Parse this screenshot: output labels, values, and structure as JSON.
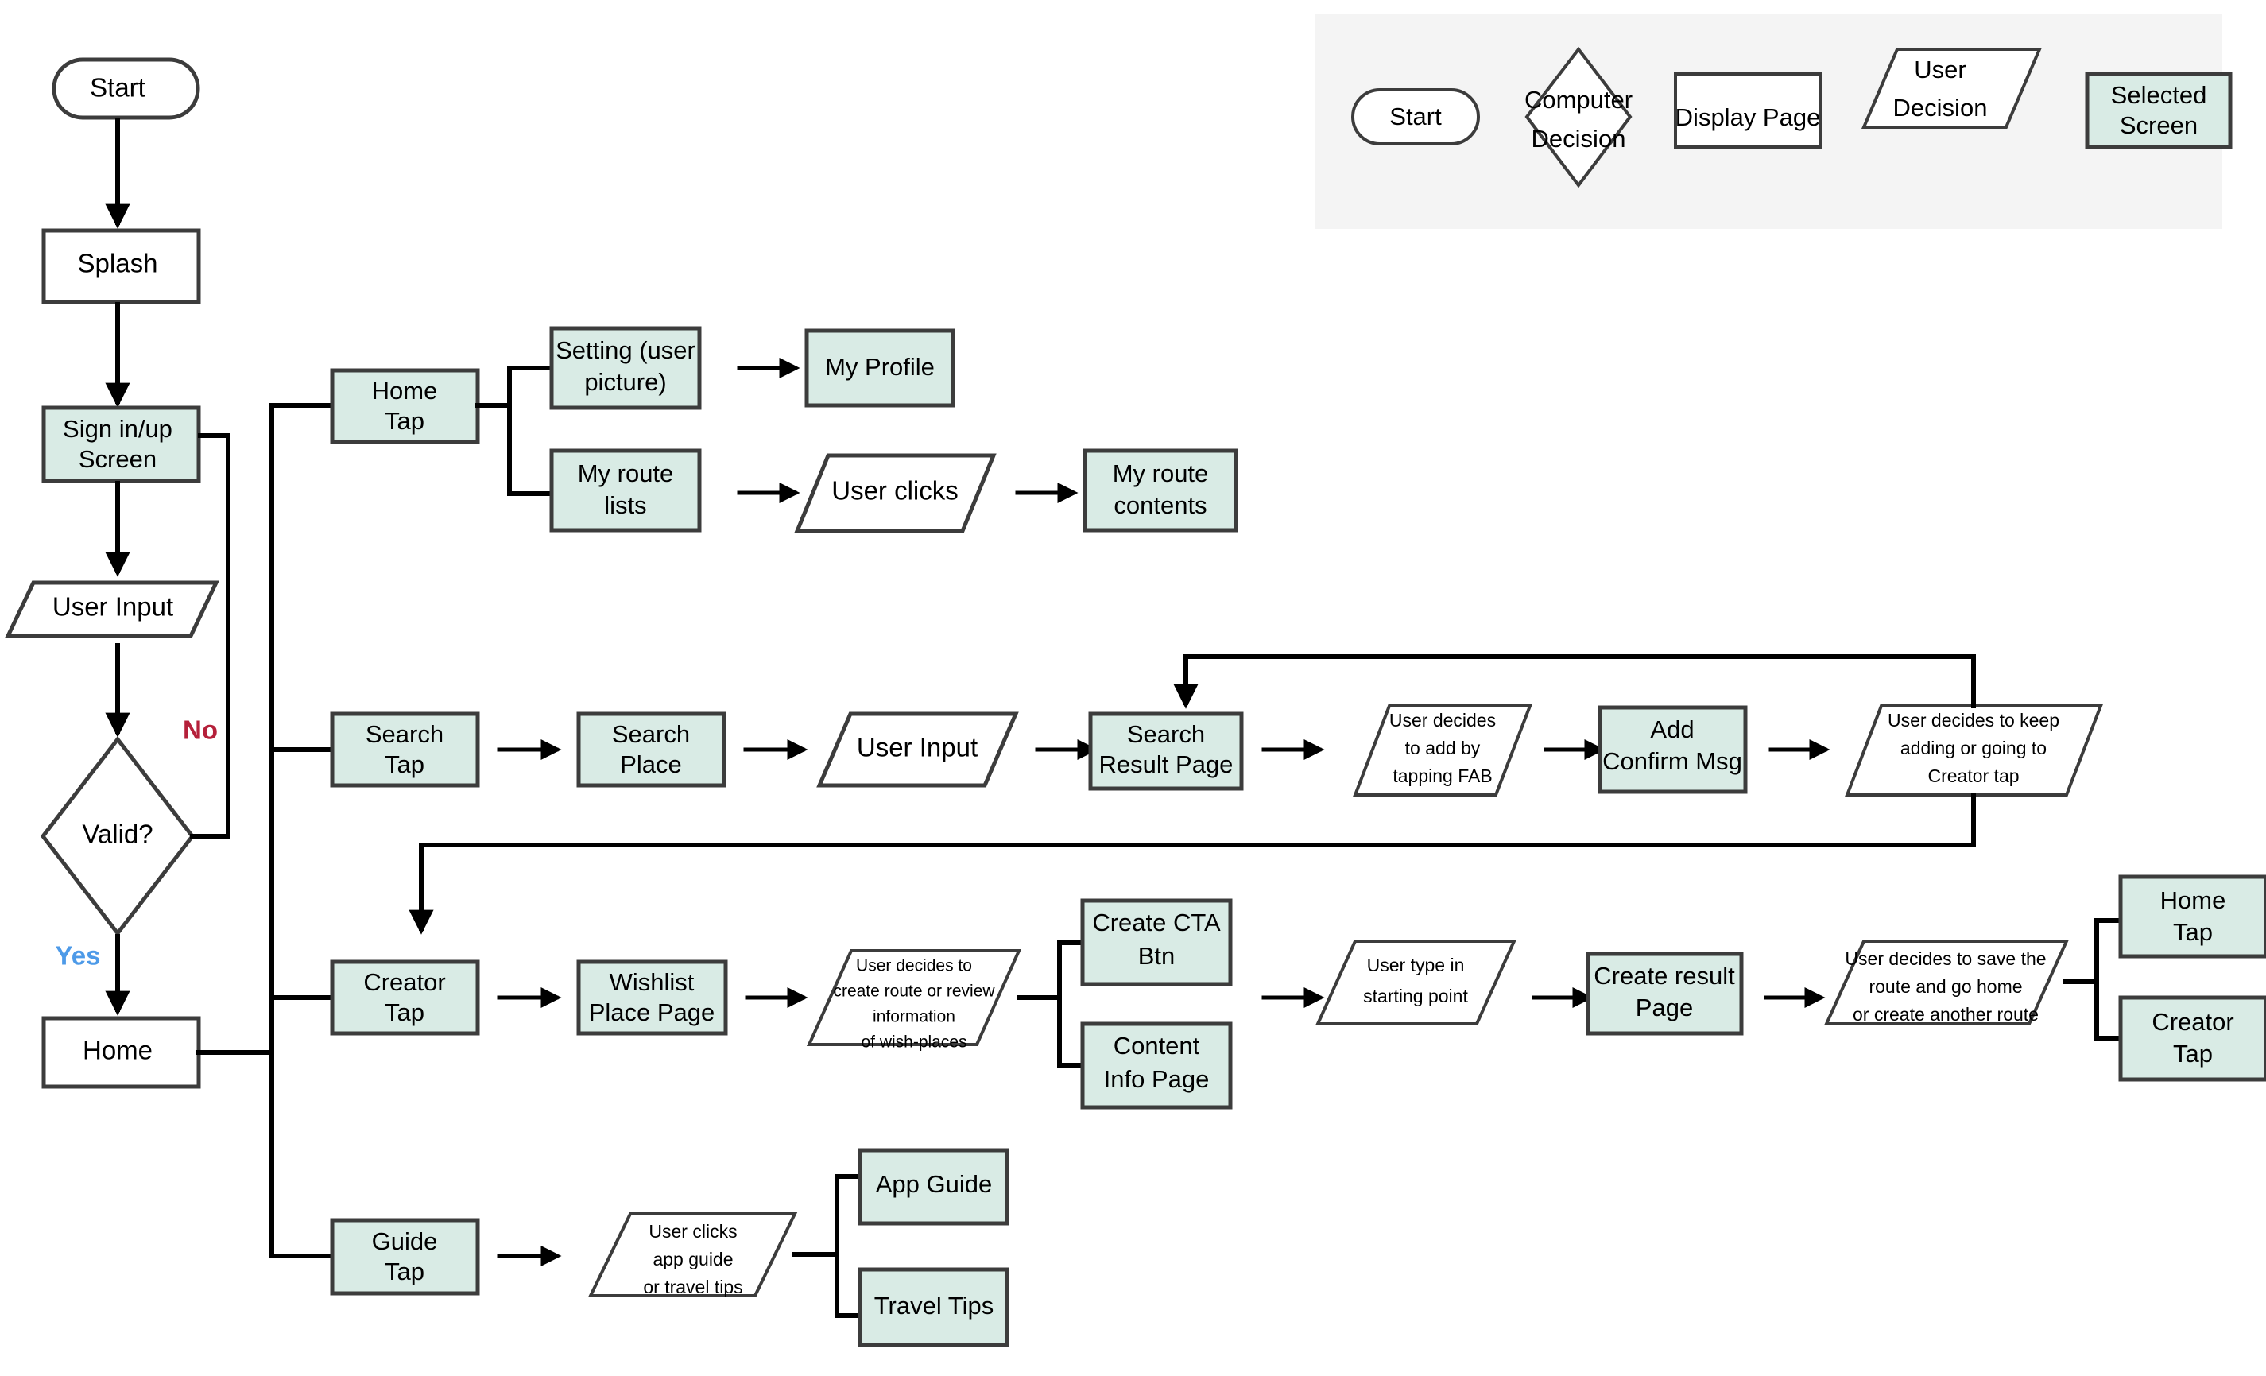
{
  "legend": {
    "title": "",
    "items": [
      {
        "id": "start",
        "label": "Start",
        "shape": "terminator"
      },
      {
        "id": "computer",
        "label": "Computer\nDecision",
        "shape": "diamond"
      },
      {
        "id": "display",
        "label": "Display Page",
        "shape": "rect"
      },
      {
        "id": "userdec",
        "label": "User\nDecision",
        "shape": "parallelogram"
      },
      {
        "id": "selected",
        "label": "Selected\nScreen",
        "shape": "rect-filled"
      }
    ],
    "background_color": "#f4f4f4"
  },
  "colors": {
    "screen_fill": "#d9ebe5",
    "shape_stroke": "#3c3c3c",
    "connector": "#000000",
    "no_label": "#b5203a",
    "yes_label": "#4d9ae8",
    "page_background": "#ffffff"
  },
  "edge_labels": {
    "no": "No",
    "yes": "Yes"
  },
  "nodes": {
    "start": {
      "label": "Start",
      "shape": "terminator"
    },
    "splash": {
      "label": "Splash",
      "shape": "rect"
    },
    "signin": {
      "label": "Sign in/up\nScreen",
      "shape": "rect-filled"
    },
    "user_input_login": {
      "label": "User Input",
      "shape": "parallelogram"
    },
    "valid": {
      "label": "Valid?",
      "shape": "diamond"
    },
    "home": {
      "label": "Home",
      "shape": "rect"
    },
    "home_tap": {
      "label": "Home\nTap",
      "shape": "rect-filled"
    },
    "setting": {
      "label": "Setting (user\npicture)",
      "shape": "rect-filled"
    },
    "my_profile": {
      "label": "My Profile",
      "shape": "rect-filled"
    },
    "my_route_lists": {
      "label": "My route\nlists",
      "shape": "rect-filled"
    },
    "user_clicks_route": {
      "label": "User clicks",
      "shape": "parallelogram"
    },
    "my_route_contents": {
      "label": "My route\ncontents",
      "shape": "rect-filled"
    },
    "search_tap": {
      "label": "Search\nTap",
      "shape": "rect-filled"
    },
    "search_place": {
      "label": "Search\nPlace",
      "shape": "rect-filled"
    },
    "user_input_search": {
      "label": "User Input",
      "shape": "parallelogram"
    },
    "search_result": {
      "label": "Search\nResult Page",
      "shape": "rect-filled"
    },
    "decide_add_fab": {
      "label": "User decides\nto add by\ntapping FAB",
      "shape": "parallelogram"
    },
    "add_confirm": {
      "label": "Add\nConfirm Msg",
      "shape": "rect-filled"
    },
    "decide_keep_add": {
      "label": "User decides to keep\nadding or going to\nCreator tap",
      "shape": "parallelogram"
    },
    "creator_tap": {
      "label": "Creator\nTap",
      "shape": "rect-filled"
    },
    "wishlist": {
      "label": "Wishlist\nPlace Page",
      "shape": "rect-filled"
    },
    "decide_create": {
      "label": "User decides to\ncreate route or review\ninformation\nof wish-places",
      "shape": "parallelogram"
    },
    "create_cta": {
      "label": "Create CTA\nBtn",
      "shape": "rect-filled"
    },
    "content_info": {
      "label": "Content\nInfo Page",
      "shape": "rect-filled"
    },
    "type_start_point": {
      "label": "User type in\nstarting point",
      "shape": "parallelogram"
    },
    "create_result": {
      "label": "Create result\nPage",
      "shape": "rect-filled"
    },
    "decide_save": {
      "label": "User decides to save the\nroute and go home\nor create another route",
      "shape": "parallelogram"
    },
    "home_tap_end": {
      "label": "Home\nTap",
      "shape": "rect-filled"
    },
    "creator_tap_end": {
      "label": "Creator\nTap",
      "shape": "rect-filled"
    },
    "guide_tap": {
      "label": "Guide\nTap",
      "shape": "rect-filled"
    },
    "user_clicks_guide": {
      "label": "User clicks\napp guide\nor travel tips",
      "shape": "parallelogram"
    },
    "app_guide": {
      "label": "App Guide",
      "shape": "rect-filled"
    },
    "travel_tips": {
      "label": "Travel Tips",
      "shape": "rect-filled"
    }
  }
}
